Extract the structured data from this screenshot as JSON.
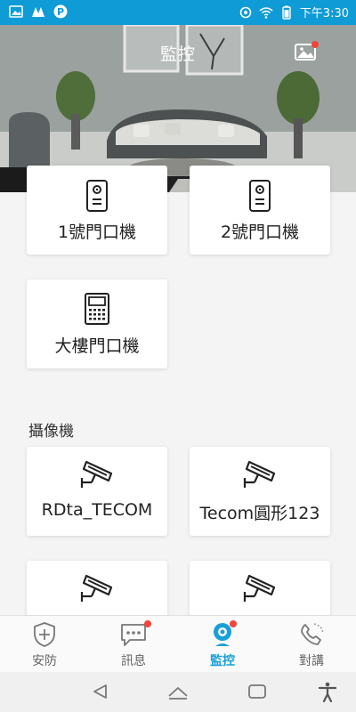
{
  "status_bar": {
    "left_icons": [
      "gallery-icon",
      "app-icon",
      "parking-icon"
    ],
    "right_icons": [
      "link-icon",
      "wifi-icon",
      "battery-icon"
    ],
    "time": "下午3:30",
    "color": "#0f9bd6"
  },
  "header": {
    "title": "監控",
    "gallery_icon": "image-icon"
  },
  "doors": [
    {
      "label": "1號門口機",
      "icon": "door-intercom-icon"
    },
    {
      "label": "2號門口機",
      "icon": "door-intercom-icon"
    },
    {
      "label": "大樓門口機",
      "icon": "building-intercom-icon"
    }
  ],
  "cameras_section": {
    "title": "攝像機",
    "items": [
      {
        "label": "RDta_TECOM",
        "icon": "camera-icon"
      },
      {
        "label": "Tecom圓形123",
        "icon": "camera-icon"
      },
      {
        "label": "",
        "icon": "camera-icon"
      },
      {
        "label": "",
        "icon": "camera-icon"
      }
    ]
  },
  "bottom_nav": [
    {
      "label": "安防",
      "icon": "shield-plus-icon",
      "active": false
    },
    {
      "label": "訊息",
      "icon": "message-icon",
      "active": false
    },
    {
      "label": "監控",
      "icon": "webcam-icon",
      "active": true
    },
    {
      "label": "對講",
      "icon": "phone-icon",
      "active": false
    }
  ],
  "colors": {
    "accent": "#18a0d8",
    "badge": "#f0453b",
    "background": "#f4f4f4"
  }
}
